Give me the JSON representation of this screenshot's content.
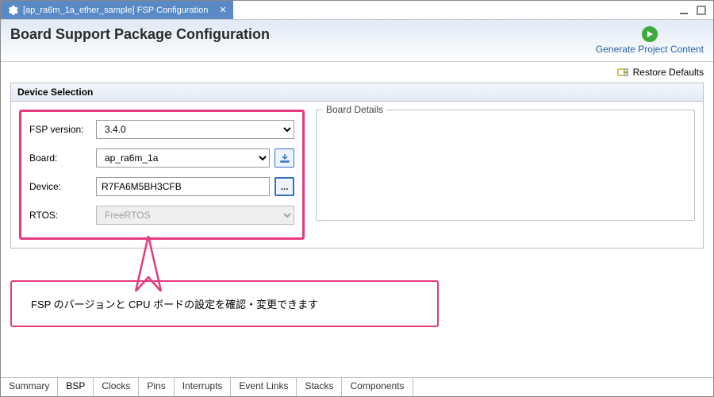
{
  "tab": {
    "title": "[ap_ra6m_1a_ether_sample] FSP Configuration"
  },
  "header": {
    "title": "Board Support Package Configuration",
    "generate_label": "Generate Project Content"
  },
  "toolbar": {
    "restore": "Restore Defaults"
  },
  "group": {
    "title": "Device Selection",
    "board_details_label": "Board Details"
  },
  "form": {
    "fsp_version": {
      "label": "FSP version:",
      "value": "3.4.0"
    },
    "board": {
      "label": "Board:",
      "value": "ap_ra6m_1a"
    },
    "device": {
      "label": "Device:",
      "value": "R7FA6M5BH3CFB",
      "browse": "..."
    },
    "rtos": {
      "label": "RTOS:",
      "value": "FreeRTOS"
    }
  },
  "callout": {
    "text": "FSP のバージョンと CPU ボードの設定を確認・変更できます"
  },
  "bottom_tabs": [
    "Summary",
    "BSP",
    "Clocks",
    "Pins",
    "Interrupts",
    "Event Links",
    "Stacks",
    "Components"
  ],
  "bottom_selected": 1
}
